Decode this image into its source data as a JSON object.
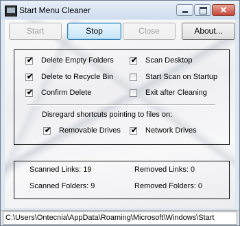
{
  "window": {
    "title": "Start Menu Cleaner"
  },
  "toolbar": {
    "start_label": "Start",
    "stop_label": "Stop",
    "close_label": "Close",
    "about_label": "About..."
  },
  "options": {
    "delete_empty_folders": {
      "label": "Delete Empty Folders",
      "checked": true
    },
    "scan_desktop": {
      "label": "Scan Desktop",
      "checked": true
    },
    "delete_to_recycle_bin": {
      "label": "Delete to Recycle Bin",
      "checked": true
    },
    "start_scan_on_startup": {
      "label": "Start Scan on Startup",
      "checked": false
    },
    "confirm_delete": {
      "label": "Confirm Delete",
      "checked": true
    },
    "exit_after_cleaning": {
      "label": "Exit after Cleaning",
      "checked": false
    },
    "disregard_heading": "Disregard shortcuts pointing to files on:",
    "removable_drives": {
      "label": "Removable Drives",
      "checked": true
    },
    "network_drives": {
      "label": "Network Drives",
      "checked": true
    }
  },
  "stats": {
    "scanned_links": "Scanned Links: 19",
    "removed_links": "Removed Links: 0",
    "scanned_folders": "Scanned Folders: 9",
    "removed_folders": "Removed Folders: 0"
  },
  "status_bar": {
    "path": "C:\\Users\\Ontecnia\\AppData\\Roaming\\Microsoft\\Windows\\Start"
  },
  "icons": {
    "app": "start-menu-cleaner-app-icon",
    "check": "checkmark-icon"
  }
}
